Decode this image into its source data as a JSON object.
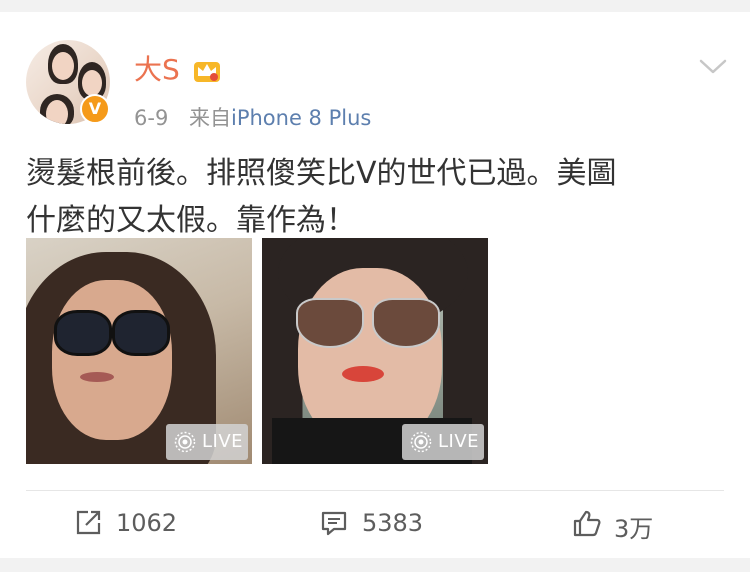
{
  "post": {
    "username": "大S",
    "date": "6-9",
    "source_prefix": "来自",
    "source_device": "iPhone 8 Plus",
    "text_line1": "燙髮根前後。排照傻笑比V的世代已過。美圖",
    "text_line2": "什麼的又太假。靠作為！"
  },
  "photos": [
    {
      "live_label": "LIVE"
    },
    {
      "live_label": "LIVE"
    }
  ],
  "actions": {
    "repost_count": "1062",
    "comment_count": "5383",
    "like_count": "3万"
  },
  "colors": {
    "username": "#eb7350",
    "source_link": "#5d7fae",
    "meta": "#939393",
    "text": "#333333",
    "verified_badge": "#f59a1a"
  },
  "icons": [
    "verified-v-icon",
    "crown-icon",
    "chevron-down-icon",
    "live-icon",
    "repost-icon",
    "comment-icon",
    "like-icon"
  ]
}
